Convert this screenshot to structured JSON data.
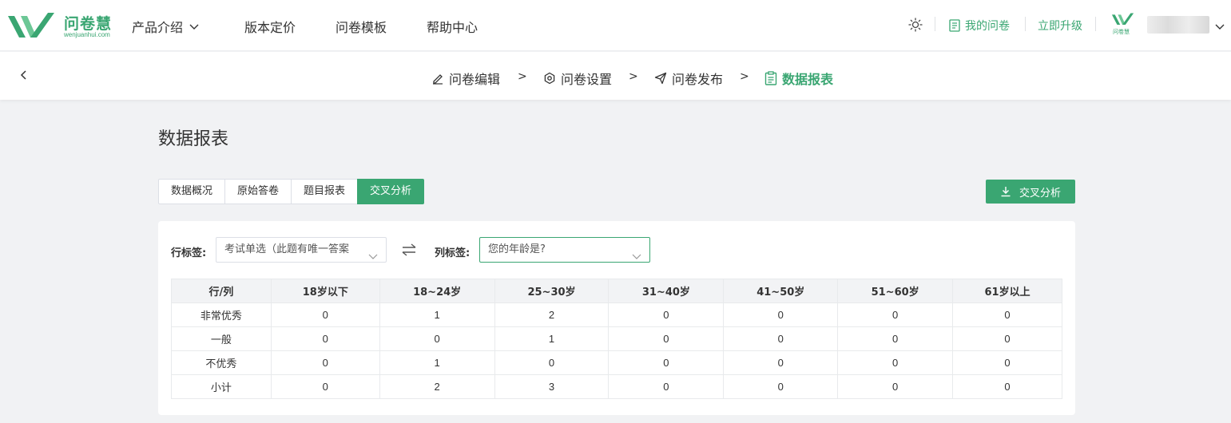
{
  "brand": {
    "name": "问卷慧",
    "sub": "wenjuanhui.com",
    "accent": "#3aa672"
  },
  "nav": [
    {
      "label": "产品介绍",
      "dropdown": true
    },
    {
      "label": "版本定价"
    },
    {
      "label": "问卷模板"
    },
    {
      "label": "帮助中心"
    }
  ],
  "top_right": {
    "my_surveys": "我的问卷",
    "upgrade": "立即升级",
    "mini_logo": "问卷慧"
  },
  "steps": [
    {
      "label": "问卷编辑",
      "icon": "edit-icon"
    },
    {
      "label": "问卷设置",
      "icon": "settings-icon"
    },
    {
      "label": "问卷发布",
      "icon": "send-icon"
    },
    {
      "label": "数据报表",
      "icon": "clipboard-icon",
      "active": true
    }
  ],
  "step_separator": ">",
  "page": {
    "title": "数据报表",
    "tabs": [
      "数据概况",
      "原始答卷",
      "题目报表",
      "交叉分析"
    ],
    "active_tab": 3,
    "export_label": "交叉分析"
  },
  "filters": {
    "row_label": "行标签:",
    "row_value": "考试单选（此题有唯一答案",
    "col_label": "列标签:",
    "col_value": "您的年龄是?"
  },
  "table": {
    "columns": [
      "行/列",
      "18岁以下",
      "18~24岁",
      "25~30岁",
      "31~40岁",
      "41~50岁",
      "51~60岁",
      "61岁以上"
    ],
    "rows": [
      {
        "label": "非常优秀",
        "values": [
          "0",
          "1",
          "2",
          "0",
          "0",
          "0",
          "0"
        ]
      },
      {
        "label": "一般",
        "values": [
          "0",
          "0",
          "1",
          "0",
          "0",
          "0",
          "0"
        ]
      },
      {
        "label": "不优秀",
        "values": [
          "0",
          "1",
          "0",
          "0",
          "0",
          "0",
          "0"
        ]
      },
      {
        "label": "小计",
        "values": [
          "0",
          "2",
          "3",
          "0",
          "0",
          "0",
          "0"
        ]
      }
    ]
  }
}
